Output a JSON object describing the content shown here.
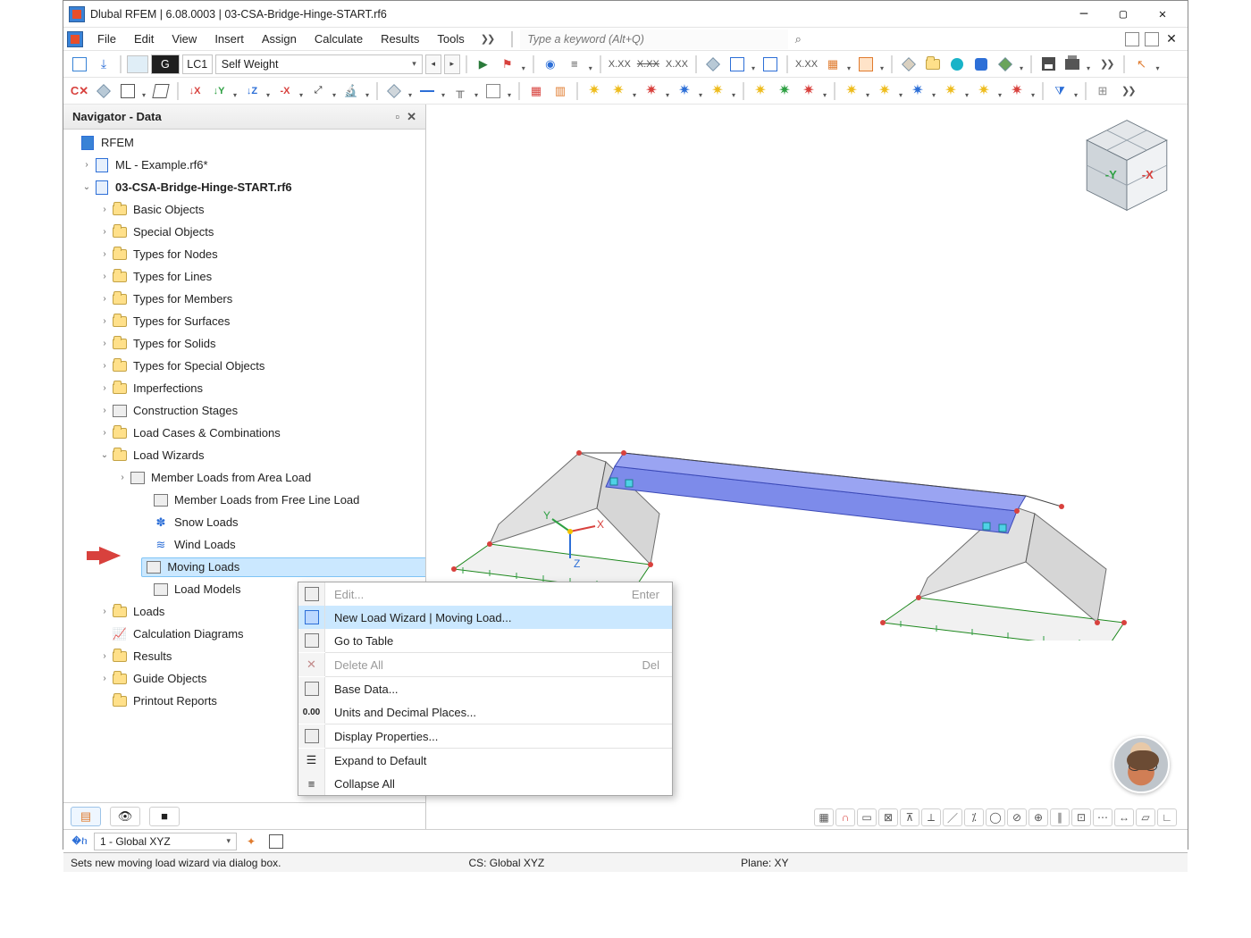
{
  "titlebar": {
    "title": "Dlubal RFEM | 6.08.0003 | 03-CSA-Bridge-Hinge-START.rf6"
  },
  "menubar": {
    "items": [
      "File",
      "Edit",
      "View",
      "Insert",
      "Assign",
      "Calculate",
      "Results",
      "Tools"
    ],
    "search_placeholder": "Type a keyword (Alt+Q)"
  },
  "toolbar": {
    "load_case_tag": "G",
    "load_case_code": "LC1",
    "load_case_name": "Self Weight",
    "xxx_labels": [
      "X.XX",
      "X.XX",
      "X.XX",
      "X.XX"
    ]
  },
  "navigator": {
    "title": "Navigator - Data",
    "root": "RFEM",
    "files": [
      {
        "name": "ML - Example.rf6*",
        "expanded": false,
        "active": false
      },
      {
        "name": "03-CSA-Bridge-Hinge-START.rf6",
        "expanded": true,
        "active": true
      }
    ],
    "folders1": [
      "Basic Objects",
      "Special Objects",
      "Types for Nodes",
      "Types for Lines",
      "Types for Members",
      "Types for Surfaces",
      "Types for Solids",
      "Types for Special Objects",
      "Imperfections"
    ],
    "construction_stages": "Construction Stages",
    "load_cases": "Load Cases & Combinations",
    "load_wizards": "Load Wizards",
    "wizards": [
      "Member Loads from Area Load",
      "Member Loads from Free Line Load",
      "Snow Loads",
      "Wind Loads",
      "Moving Loads",
      "Load Models"
    ],
    "folders2": [
      "Loads",
      "Calculation Diagrams",
      "Results",
      "Guide Objects",
      "Printout Reports"
    ]
  },
  "context_menu": {
    "items": [
      {
        "label": "Edit...",
        "shortcut": "Enter",
        "disabled": true
      },
      {
        "label": "New Load Wizard | Moving Load...",
        "hover": true
      },
      {
        "label": "Go to Table"
      },
      {
        "sep": true
      },
      {
        "label": "Delete All",
        "shortcut": "Del",
        "disabled": true
      },
      {
        "sep": true
      },
      {
        "label": "Base Data..."
      },
      {
        "label": "Units and Decimal Places..."
      },
      {
        "sep": true
      },
      {
        "label": "Display Properties..."
      },
      {
        "sep": true
      },
      {
        "label": "Expand to Default"
      },
      {
        "label": "Collapse All"
      }
    ]
  },
  "cs_bar": {
    "combo": "1 - Global XYZ"
  },
  "statusbar": {
    "hint": "Sets new moving load wizard via dialog box.",
    "cs": "CS: Global XYZ",
    "plane": "Plane: XY"
  },
  "cube": {
    "axes": [
      "-Y",
      "-X"
    ]
  }
}
